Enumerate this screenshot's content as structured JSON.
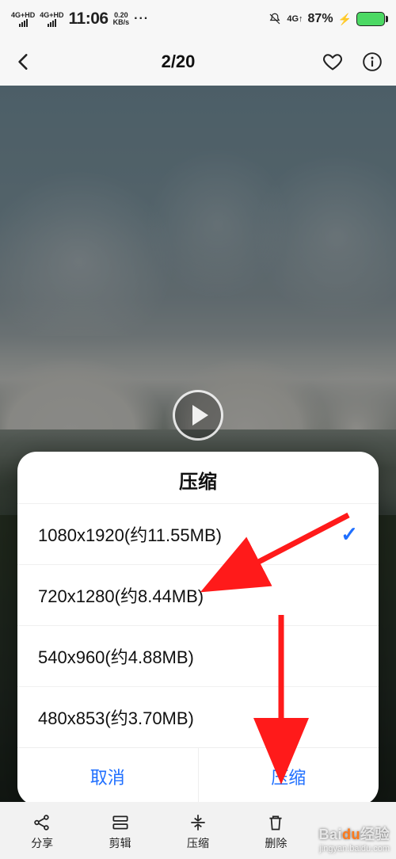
{
  "status": {
    "net1_label": "4G+HD",
    "net2_label": "4G+HD",
    "time": "11:06",
    "speed_top": "0.20",
    "speed_bottom": "KB/s",
    "more": "···",
    "net_right": "4G↑",
    "battery_pct": "87%"
  },
  "nav": {
    "counter": "2/20"
  },
  "dialog": {
    "title": "压缩",
    "options": [
      {
        "label": "1080x1920(约11.55MB)",
        "selected": true
      },
      {
        "label": "720x1280(约8.44MB)",
        "selected": false
      },
      {
        "label": "540x960(约4.88MB)",
        "selected": false
      },
      {
        "label": "480x853(约3.70MB)",
        "selected": false
      }
    ],
    "cancel": "取消",
    "confirm": "压缩"
  },
  "toolbar": {
    "share": "分享",
    "edit": "剪辑",
    "compress": "压缩",
    "delete": "删除"
  },
  "watermark": {
    "line1_a": "Bai",
    "line1_b": "du",
    "line1_c": "经验",
    "line2": "jingyan.baidu.com"
  }
}
